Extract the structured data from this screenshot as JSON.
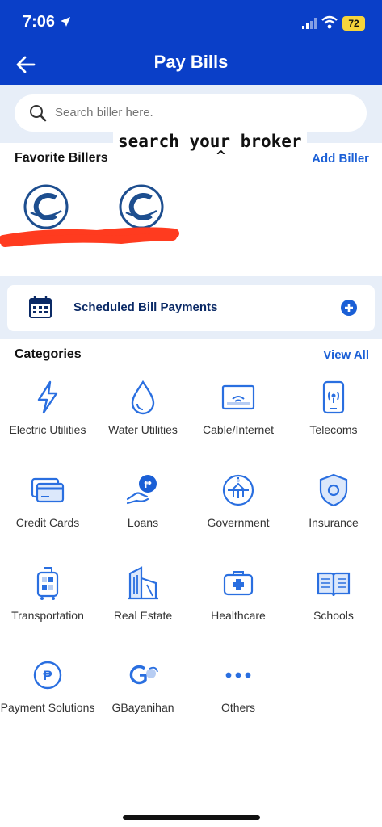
{
  "status_bar": {
    "time": "7:06",
    "battery": "72"
  },
  "header": {
    "title": "Pay Bills"
  },
  "search": {
    "placeholder": "Search biller here."
  },
  "annotation": {
    "text": "search your broker",
    "caret": "^"
  },
  "favorites": {
    "title": "Favorite Billers",
    "add_label": "Add Biller"
  },
  "scheduled": {
    "label": "Scheduled Bill Payments"
  },
  "categories": {
    "title": "Categories",
    "view_all": "View All",
    "items": [
      {
        "label": "Electric Utilities",
        "icon": "lightning-icon"
      },
      {
        "label": "Water Utilities",
        "icon": "water-drop-icon"
      },
      {
        "label": "Cable/Internet",
        "icon": "router-icon"
      },
      {
        "label": "Telecoms",
        "icon": "phone-icon"
      },
      {
        "label": "Credit Cards",
        "icon": "credit-card-icon"
      },
      {
        "label": "Loans",
        "icon": "loan-icon"
      },
      {
        "label": "Government",
        "icon": "government-icon"
      },
      {
        "label": "Insurance",
        "icon": "shield-icon"
      },
      {
        "label": "Transportation",
        "icon": "luggage-icon"
      },
      {
        "label": "Real Estate",
        "icon": "building-icon"
      },
      {
        "label": "Healthcare",
        "icon": "medical-kit-icon"
      },
      {
        "label": "Schools",
        "icon": "book-icon"
      },
      {
        "label": "Payment Solutions",
        "icon": "peso-coin-icon"
      },
      {
        "label": "GBayanihan",
        "icon": "gbayanihan-icon"
      },
      {
        "label": "Others",
        "icon": "more-dots-icon"
      }
    ]
  },
  "colors": {
    "brand_blue": "#0a3fc8",
    "accent_blue": "#1a5fd6",
    "icon_blue": "#2a6fe0",
    "redaction_red": "#ff3b1f"
  }
}
